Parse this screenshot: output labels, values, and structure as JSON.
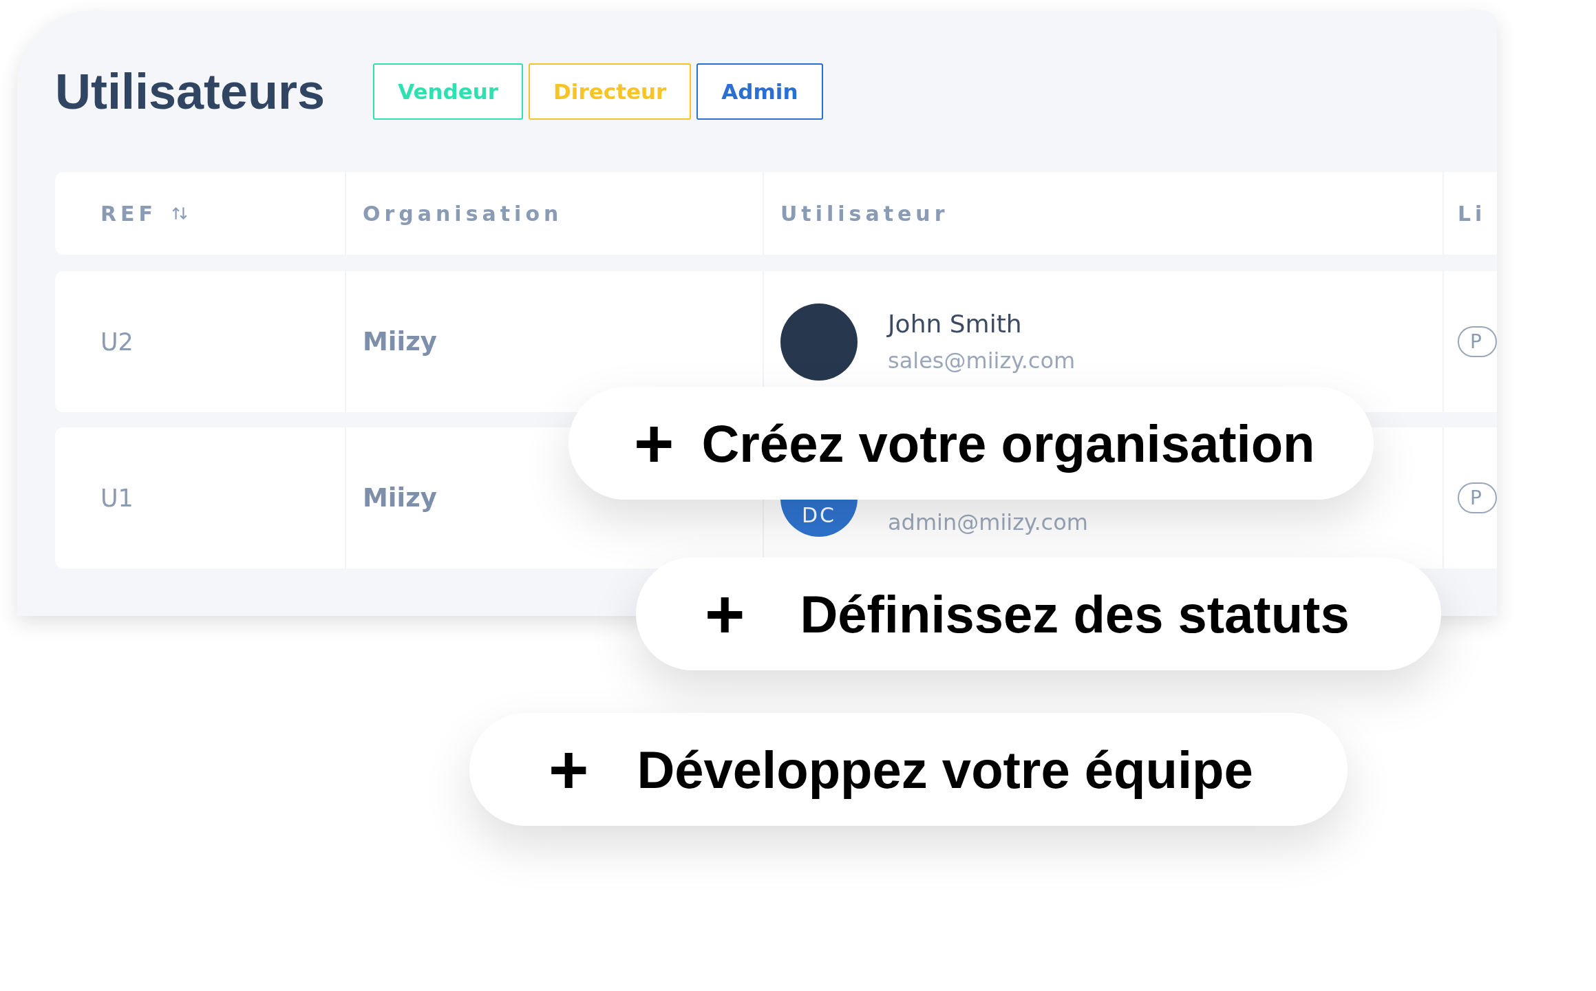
{
  "title": "Utilisateurs",
  "tags": [
    {
      "label": "Vendeur",
      "color": "#2fe0b0"
    },
    {
      "label": "Directeur",
      "color": "#f7c325"
    },
    {
      "label": "Admin",
      "color": "#2a6fd1"
    }
  ],
  "table": {
    "columns": [
      {
        "label": "REF",
        "sortable": true
      },
      {
        "label": "Organisation"
      },
      {
        "label": "Utilisateur"
      },
      {
        "label": "Li"
      }
    ],
    "rows": [
      {
        "ref": "U2",
        "organisation": "Miizy",
        "user": {
          "name": "John Smith",
          "email": "sales@miizy.com",
          "kind": "photo"
        },
        "licence": "P"
      },
      {
        "ref": "U1",
        "organisation": "Miizy",
        "user": {
          "email": "admin@miizy.com",
          "kind": "initials",
          "initials": "DC"
        },
        "licence": "P"
      }
    ]
  },
  "callouts": [
    {
      "icon": "+",
      "text": "Créez votre organisation"
    },
    {
      "icon": "+",
      "text": "Définissez des statuts"
    },
    {
      "icon": "+",
      "text": "Développez votre équipe"
    }
  ]
}
